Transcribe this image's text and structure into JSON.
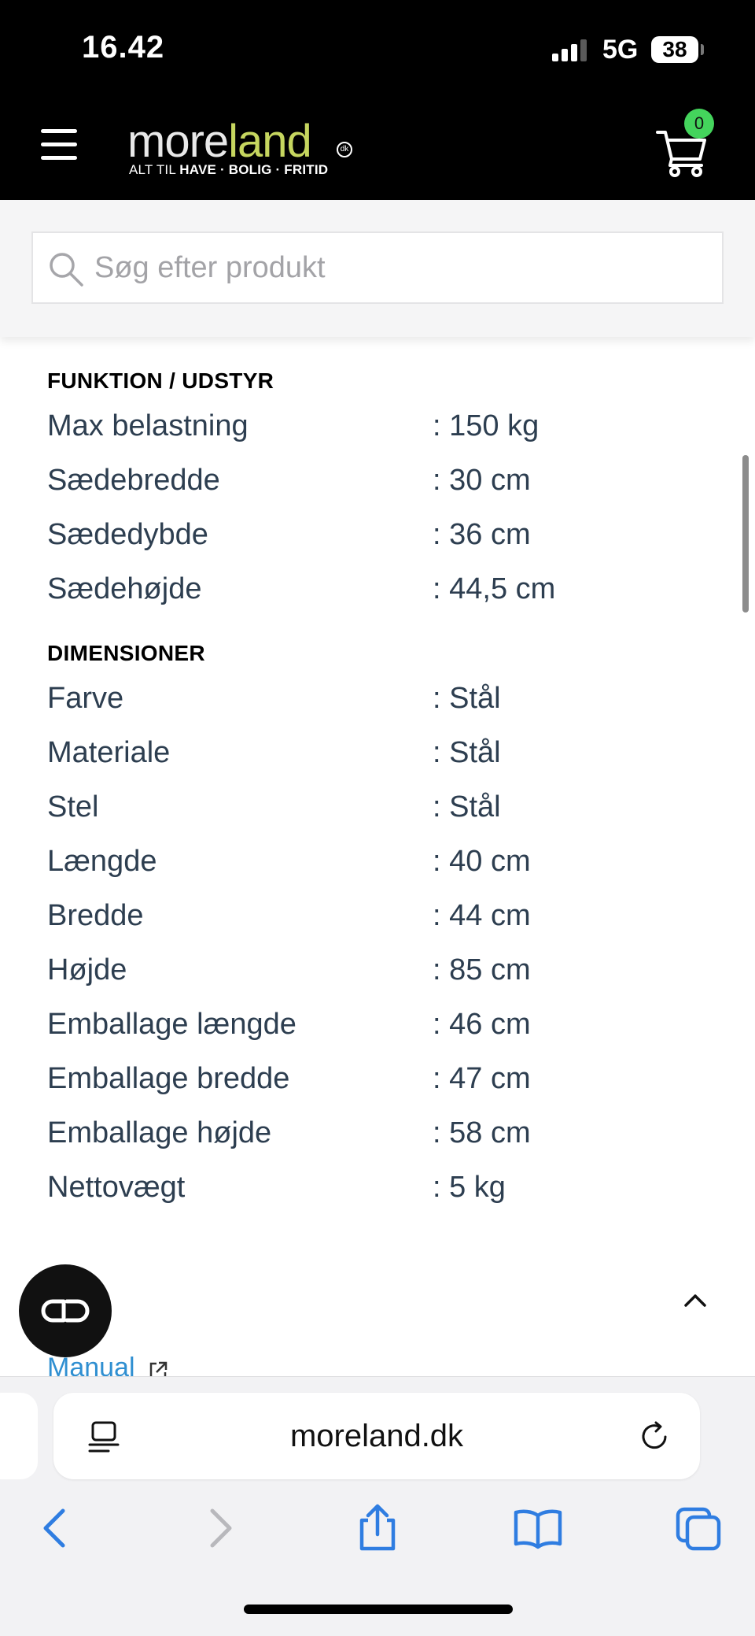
{
  "status_bar": {
    "time": "16.42",
    "network": "5G",
    "battery": "38"
  },
  "header": {
    "logo": {
      "brand_main": "more",
      "brand_accent": "land",
      "brand_suffix": "dk",
      "tagline_prefix": "ALT TIL",
      "tagline_bold": "HAVE · BOLIG · FRITID"
    },
    "cart_count": "0"
  },
  "search": {
    "placeholder": "Søg efter produkt"
  },
  "specs": {
    "funktion": {
      "heading": "FUNKTION / UDSTYR",
      "rows": [
        {
          "label": "Max belastning",
          "value": ": 150 kg"
        },
        {
          "label": "Sædebredde",
          "value": ": 30 cm"
        },
        {
          "label": "Sædedybde",
          "value": ": 36 cm"
        },
        {
          "label": "Sædehøjde",
          "value": ": 44,5 cm"
        }
      ]
    },
    "dimensioner": {
      "heading": "DIMENSIONER",
      "rows": [
        {
          "label": "Farve",
          "value": ": Stål"
        },
        {
          "label": "Materiale",
          "value": ": Stål"
        },
        {
          "label": "Stel",
          "value": ": Stål"
        },
        {
          "label": "Længde",
          "value": ": 40 cm"
        },
        {
          "label": "Bredde",
          "value": ": 44 cm"
        },
        {
          "label": "Højde",
          "value": ": 85 cm"
        },
        {
          "label": "Emballage længde",
          "value": ": 46 cm"
        },
        {
          "label": "Emballage bredde",
          "value": ": 47 cm"
        },
        {
          "label": "Emballage højde",
          "value": ": 58 cm"
        },
        {
          "label": "Nettovægt",
          "value": ": 5 kg"
        }
      ]
    }
  },
  "manual_link": "Manual",
  "browser": {
    "url": "moreland.dk"
  }
}
